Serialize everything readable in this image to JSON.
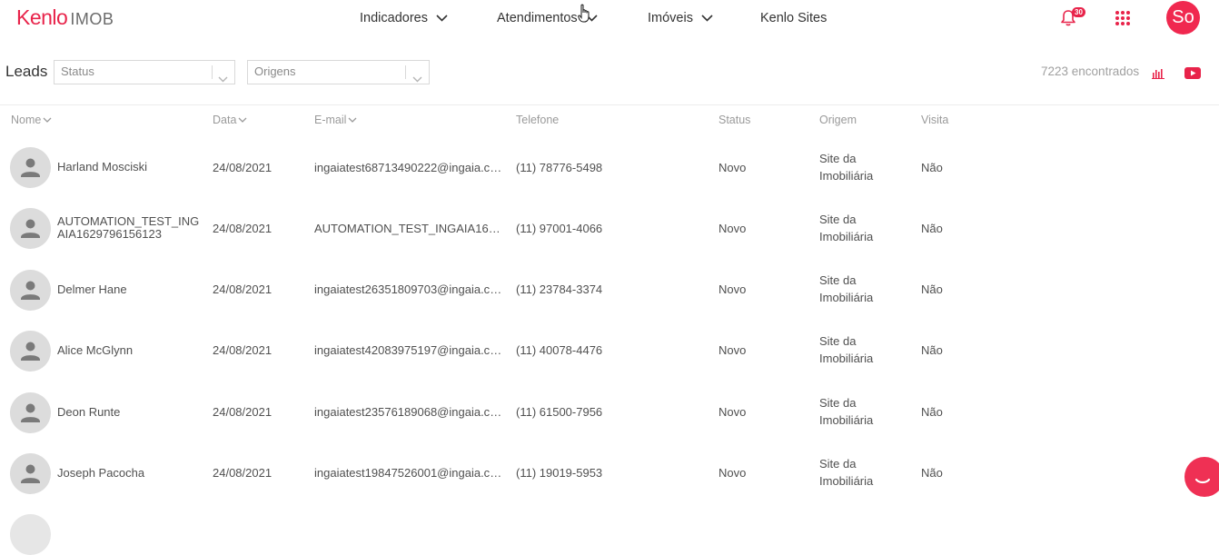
{
  "app": {
    "brand": "Kenlo",
    "product": "IMOB",
    "accent_color": "#e8234a"
  },
  "nav": {
    "items": [
      {
        "label": "Indicadores",
        "has_dropdown": true
      },
      {
        "label": "Atendimentos",
        "has_dropdown": true
      },
      {
        "label": "Imóveis",
        "has_dropdown": true
      },
      {
        "label": "Kenlo Sites",
        "has_dropdown": false
      }
    ],
    "notifications_count": "30",
    "user_initials": "So"
  },
  "filters": {
    "title": "Leads",
    "status_placeholder": "Status",
    "origens_placeholder": "Origens",
    "found_text": "7223 encontrados"
  },
  "table": {
    "columns": {
      "nome": "Nome",
      "data": "Data",
      "email": "E-mail",
      "telefone": "Telefone",
      "status": "Status",
      "origem": "Origem",
      "visita": "Visita"
    },
    "rows": [
      {
        "name": "Harland Mosciski",
        "date": "24/08/2021",
        "email": "ingaiatest68713490222@ingaia.co...",
        "phone": "(11) 78776-5498",
        "status": "Novo",
        "origin": "Site da Imobiliária",
        "visit": "Não"
      },
      {
        "name": "AUTOMATION_TEST_INGAIA1629796156123",
        "date": "24/08/2021",
        "email": "AUTOMATION_TEST_INGAIA1629...",
        "phone": "(11) 97001-4066",
        "status": "Novo",
        "origin": "Site da Imobiliária",
        "visit": "Não"
      },
      {
        "name": "Delmer Hane",
        "date": "24/08/2021",
        "email": "ingaiatest26351809703@ingaia.co...",
        "phone": "(11) 23784-3374",
        "status": "Novo",
        "origin": "Site da Imobiliária",
        "visit": "Não"
      },
      {
        "name": "Alice McGlynn",
        "date": "24/08/2021",
        "email": "ingaiatest42083975197@ingaia.co...",
        "phone": "(11) 40078-4476",
        "status": "Novo",
        "origin": "Site da Imobiliária",
        "visit": "Não"
      },
      {
        "name": "Deon Runte",
        "date": "24/08/2021",
        "email": "ingaiatest23576189068@ingaia.co...",
        "phone": "(11) 61500-7956",
        "status": "Novo",
        "origin": "Site da Imobiliária",
        "visit": "Não"
      },
      {
        "name": "Joseph Pacocha",
        "date": "24/08/2021",
        "email": "ingaiatest19847526001@ingaia.co...",
        "phone": "(11) 19019-5953",
        "status": "Novo",
        "origin": "Site da Imobiliária",
        "visit": "Não"
      }
    ]
  }
}
